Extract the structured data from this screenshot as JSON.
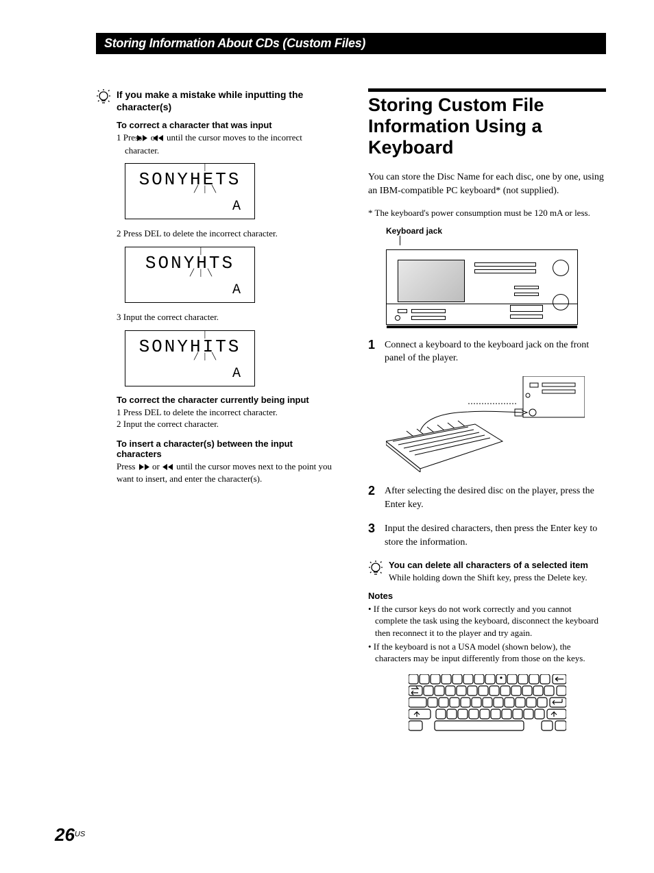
{
  "header": {
    "section_title": "Storing Information About CDs (Custom Files)"
  },
  "left": {
    "tip_title": "If you make a mistake while inputting the character(s)",
    "sub1": "To correct a character that was input",
    "step1_pre": "1  Press ",
    "step1_post": " until the cursor moves to the incorrect character.",
    "or_word": " or ",
    "lcd1": "SONYHETS",
    "lcd1_sub": "A",
    "step2": "2  Press DEL to delete the incorrect character.",
    "lcd2": "SONYHTS",
    "lcd2_sub": "A",
    "step3": "3  Input the correct character.",
    "lcd3": "SONYHITS",
    "lcd3_sub": "A",
    "sub2": "To correct the character currently being input",
    "sub2_1": "1  Press DEL to delete the incorrect character.",
    "sub2_2": "2  Input the correct character.",
    "sub3": "To insert a character(s) between the input characters",
    "sub3_pre": "Press ",
    "sub3_post": " until the cursor moves next to the point you want to insert, and enter the character(s)."
  },
  "right": {
    "heading": "Storing Custom File Information Using a Keyboard",
    "intro": "You can store the Disc Name for each disc, one by one, using an IBM-compatible PC keyboard* (not supplied).",
    "footnote": "*  The keyboard's power consumption must be 120 mA or less.",
    "jack_label": "Keyboard jack",
    "step1": "Connect a keyboard to the keyboard jack on the front panel of the player.",
    "step2": "After selecting the desired disc on the player, press the Enter key.",
    "step3": "Input the desired characters, then press the Enter key to store the information.",
    "tip2_title": "You can delete all characters of a selected item",
    "tip2_body": "While holding down the Shift key, press the Delete key.",
    "notes_h": "Notes",
    "note1": "• If the cursor keys do not work correctly and you cannot complete the task using the keyboard, disconnect the keyboard then reconnect it to the player and try again.",
    "note2": "• If the keyboard is not a USA model (shown below), the characters may be input differently from those on the keys."
  },
  "page": {
    "num": "26",
    "region": "US"
  },
  "nums": {
    "n1": "1",
    "n2": "2",
    "n3": "3"
  }
}
